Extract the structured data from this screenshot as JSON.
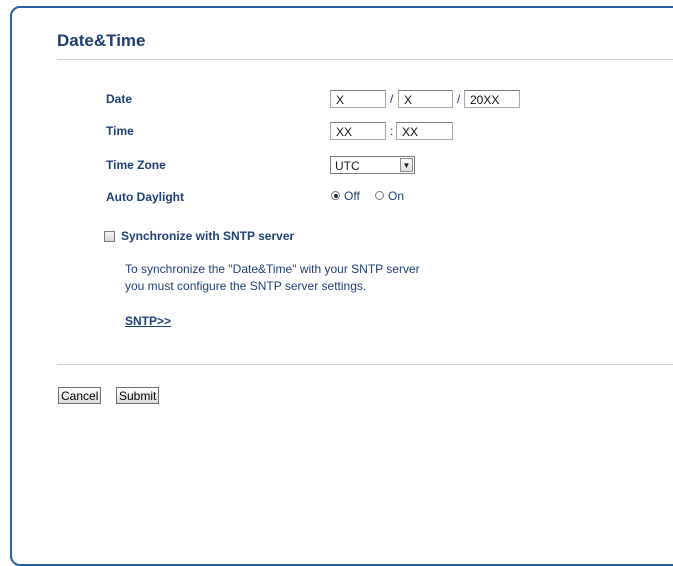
{
  "page": {
    "title": "Date&Time"
  },
  "form": {
    "date": {
      "label": "Date",
      "month": "X",
      "day": "X",
      "year": "20XX",
      "separator": "/"
    },
    "time": {
      "label": "Time",
      "hour": "XX",
      "minute": "XX",
      "separator": ":"
    },
    "time_zone": {
      "label": "Time Zone",
      "selected": "UTC"
    },
    "auto_daylight": {
      "label": "Auto Daylight",
      "options": [
        "Off",
        "On"
      ],
      "selected": "Off"
    },
    "sntp": {
      "checkbox_label": "Synchronize with SNTP server",
      "checked": false,
      "info_line1": "To synchronize the \"Date&Time\" with your SNTP server",
      "info_line2": "you must configure the SNTP server settings.",
      "link": "SNTP>>"
    }
  },
  "buttons": {
    "cancel": "Cancel",
    "submit": "Submit"
  },
  "colors": {
    "label": "#1f3f75",
    "frame": "#2a5d9c"
  }
}
